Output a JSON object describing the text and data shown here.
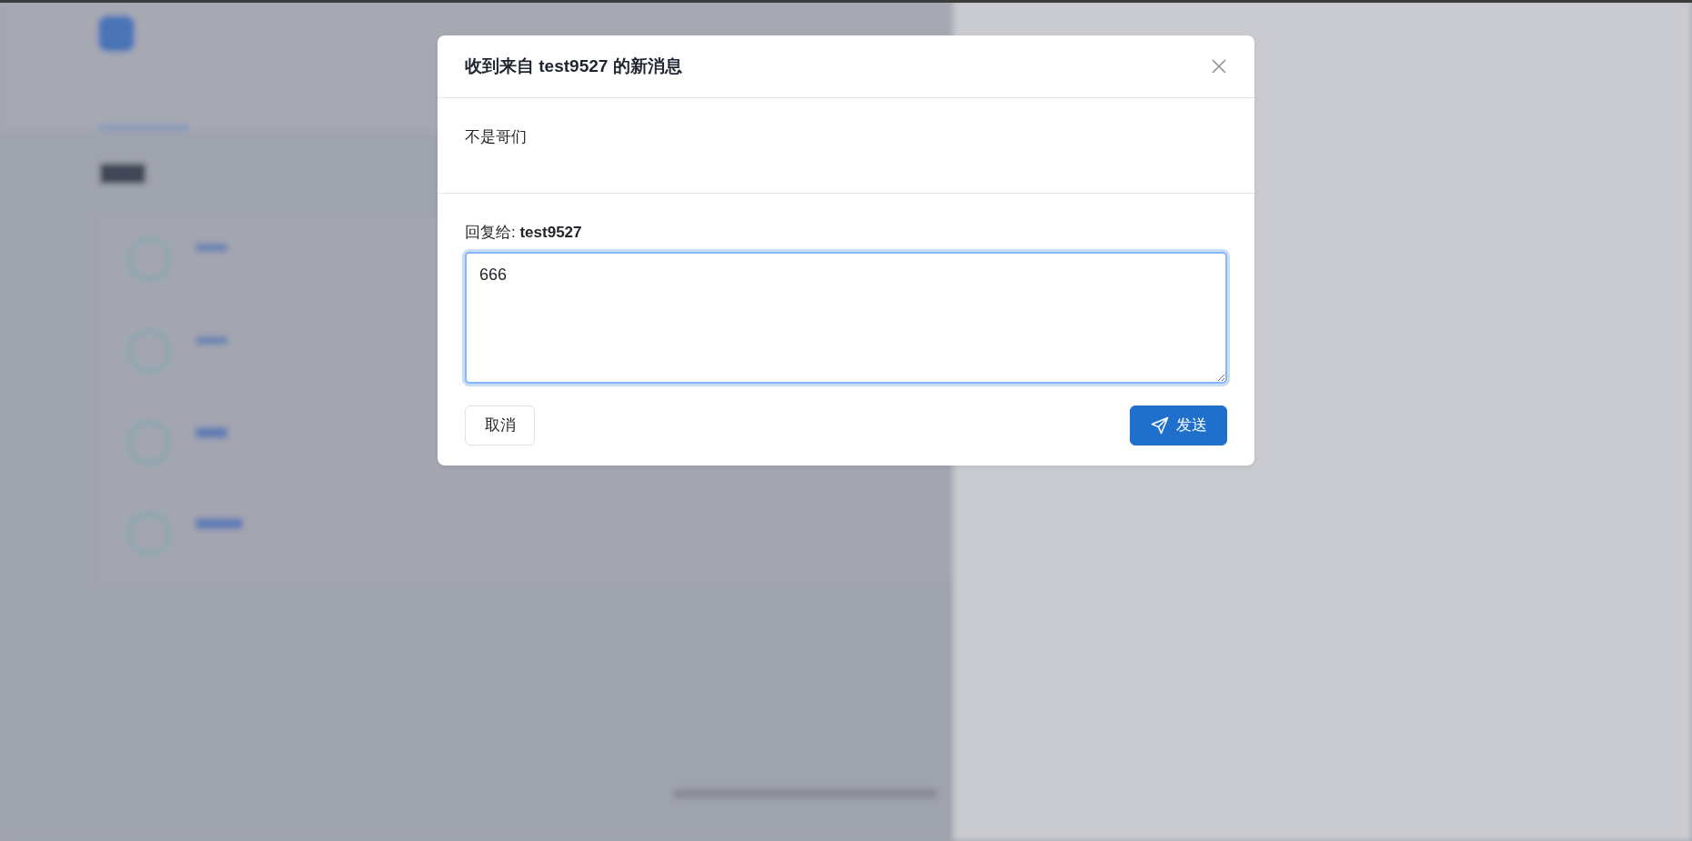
{
  "dialog": {
    "title": "收到来自 test9527 的新消息",
    "message": "不是哥们",
    "reply_label": "回复给: **test9527**",
    "reply": {
      "value": "666"
    },
    "buttons": [
      {
        "kind": "cancel",
        "label": "取消"
      },
      {
        "kind": "send",
        "label": "发送"
      }
    ]
  }
}
